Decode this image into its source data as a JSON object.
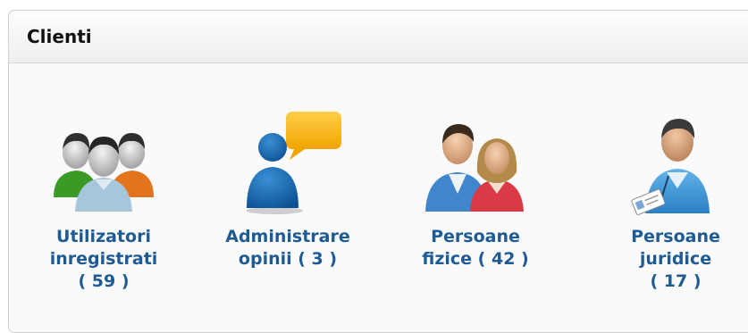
{
  "panel": {
    "title": "Clienti"
  },
  "tiles": [
    {
      "icon": "users-group-icon",
      "lines": [
        "Utilizatori",
        "inregistrati",
        "( 59 )"
      ]
    },
    {
      "icon": "user-speech-icon",
      "lines": [
        "Administrare",
        "opinii ( 3 )"
      ]
    },
    {
      "icon": "couple-icon",
      "lines": [
        "Persoane",
        "fizice ( 42 )"
      ]
    },
    {
      "icon": "user-badge-icon",
      "lines": [
        "Persoane",
        "juridice",
        "( 17 )"
      ]
    }
  ]
}
